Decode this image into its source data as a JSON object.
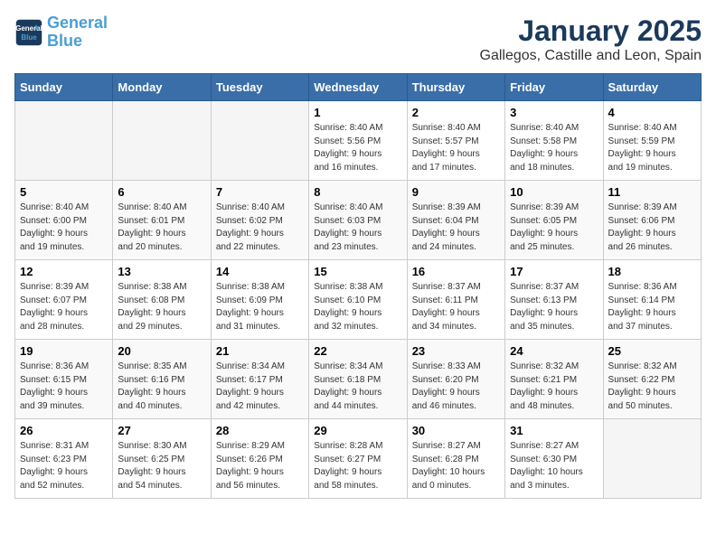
{
  "header": {
    "logo_line1": "General",
    "logo_line2": "Blue",
    "month": "January 2025",
    "location": "Gallegos, Castille and Leon, Spain"
  },
  "weekdays": [
    "Sunday",
    "Monday",
    "Tuesday",
    "Wednesday",
    "Thursday",
    "Friday",
    "Saturday"
  ],
  "weeks": [
    [
      {
        "day": "",
        "info": ""
      },
      {
        "day": "",
        "info": ""
      },
      {
        "day": "",
        "info": ""
      },
      {
        "day": "1",
        "info": "Sunrise: 8:40 AM\nSunset: 5:56 PM\nDaylight: 9 hours\nand 16 minutes."
      },
      {
        "day": "2",
        "info": "Sunrise: 8:40 AM\nSunset: 5:57 PM\nDaylight: 9 hours\nand 17 minutes."
      },
      {
        "day": "3",
        "info": "Sunrise: 8:40 AM\nSunset: 5:58 PM\nDaylight: 9 hours\nand 18 minutes."
      },
      {
        "day": "4",
        "info": "Sunrise: 8:40 AM\nSunset: 5:59 PM\nDaylight: 9 hours\nand 19 minutes."
      }
    ],
    [
      {
        "day": "5",
        "info": "Sunrise: 8:40 AM\nSunset: 6:00 PM\nDaylight: 9 hours\nand 19 minutes."
      },
      {
        "day": "6",
        "info": "Sunrise: 8:40 AM\nSunset: 6:01 PM\nDaylight: 9 hours\nand 20 minutes."
      },
      {
        "day": "7",
        "info": "Sunrise: 8:40 AM\nSunset: 6:02 PM\nDaylight: 9 hours\nand 22 minutes."
      },
      {
        "day": "8",
        "info": "Sunrise: 8:40 AM\nSunset: 6:03 PM\nDaylight: 9 hours\nand 23 minutes."
      },
      {
        "day": "9",
        "info": "Sunrise: 8:39 AM\nSunset: 6:04 PM\nDaylight: 9 hours\nand 24 minutes."
      },
      {
        "day": "10",
        "info": "Sunrise: 8:39 AM\nSunset: 6:05 PM\nDaylight: 9 hours\nand 25 minutes."
      },
      {
        "day": "11",
        "info": "Sunrise: 8:39 AM\nSunset: 6:06 PM\nDaylight: 9 hours\nand 26 minutes."
      }
    ],
    [
      {
        "day": "12",
        "info": "Sunrise: 8:39 AM\nSunset: 6:07 PM\nDaylight: 9 hours\nand 28 minutes."
      },
      {
        "day": "13",
        "info": "Sunrise: 8:38 AM\nSunset: 6:08 PM\nDaylight: 9 hours\nand 29 minutes."
      },
      {
        "day": "14",
        "info": "Sunrise: 8:38 AM\nSunset: 6:09 PM\nDaylight: 9 hours\nand 31 minutes."
      },
      {
        "day": "15",
        "info": "Sunrise: 8:38 AM\nSunset: 6:10 PM\nDaylight: 9 hours\nand 32 minutes."
      },
      {
        "day": "16",
        "info": "Sunrise: 8:37 AM\nSunset: 6:11 PM\nDaylight: 9 hours\nand 34 minutes."
      },
      {
        "day": "17",
        "info": "Sunrise: 8:37 AM\nSunset: 6:13 PM\nDaylight: 9 hours\nand 35 minutes."
      },
      {
        "day": "18",
        "info": "Sunrise: 8:36 AM\nSunset: 6:14 PM\nDaylight: 9 hours\nand 37 minutes."
      }
    ],
    [
      {
        "day": "19",
        "info": "Sunrise: 8:36 AM\nSunset: 6:15 PM\nDaylight: 9 hours\nand 39 minutes."
      },
      {
        "day": "20",
        "info": "Sunrise: 8:35 AM\nSunset: 6:16 PM\nDaylight: 9 hours\nand 40 minutes."
      },
      {
        "day": "21",
        "info": "Sunrise: 8:34 AM\nSunset: 6:17 PM\nDaylight: 9 hours\nand 42 minutes."
      },
      {
        "day": "22",
        "info": "Sunrise: 8:34 AM\nSunset: 6:18 PM\nDaylight: 9 hours\nand 44 minutes."
      },
      {
        "day": "23",
        "info": "Sunrise: 8:33 AM\nSunset: 6:20 PM\nDaylight: 9 hours\nand 46 minutes."
      },
      {
        "day": "24",
        "info": "Sunrise: 8:32 AM\nSunset: 6:21 PM\nDaylight: 9 hours\nand 48 minutes."
      },
      {
        "day": "25",
        "info": "Sunrise: 8:32 AM\nSunset: 6:22 PM\nDaylight: 9 hours\nand 50 minutes."
      }
    ],
    [
      {
        "day": "26",
        "info": "Sunrise: 8:31 AM\nSunset: 6:23 PM\nDaylight: 9 hours\nand 52 minutes."
      },
      {
        "day": "27",
        "info": "Sunrise: 8:30 AM\nSunset: 6:25 PM\nDaylight: 9 hours\nand 54 minutes."
      },
      {
        "day": "28",
        "info": "Sunrise: 8:29 AM\nSunset: 6:26 PM\nDaylight: 9 hours\nand 56 minutes."
      },
      {
        "day": "29",
        "info": "Sunrise: 8:28 AM\nSunset: 6:27 PM\nDaylight: 9 hours\nand 58 minutes."
      },
      {
        "day": "30",
        "info": "Sunrise: 8:27 AM\nSunset: 6:28 PM\nDaylight: 10 hours\nand 0 minutes."
      },
      {
        "day": "31",
        "info": "Sunrise: 8:27 AM\nSunset: 6:30 PM\nDaylight: 10 hours\nand 3 minutes."
      },
      {
        "day": "",
        "info": ""
      }
    ]
  ]
}
